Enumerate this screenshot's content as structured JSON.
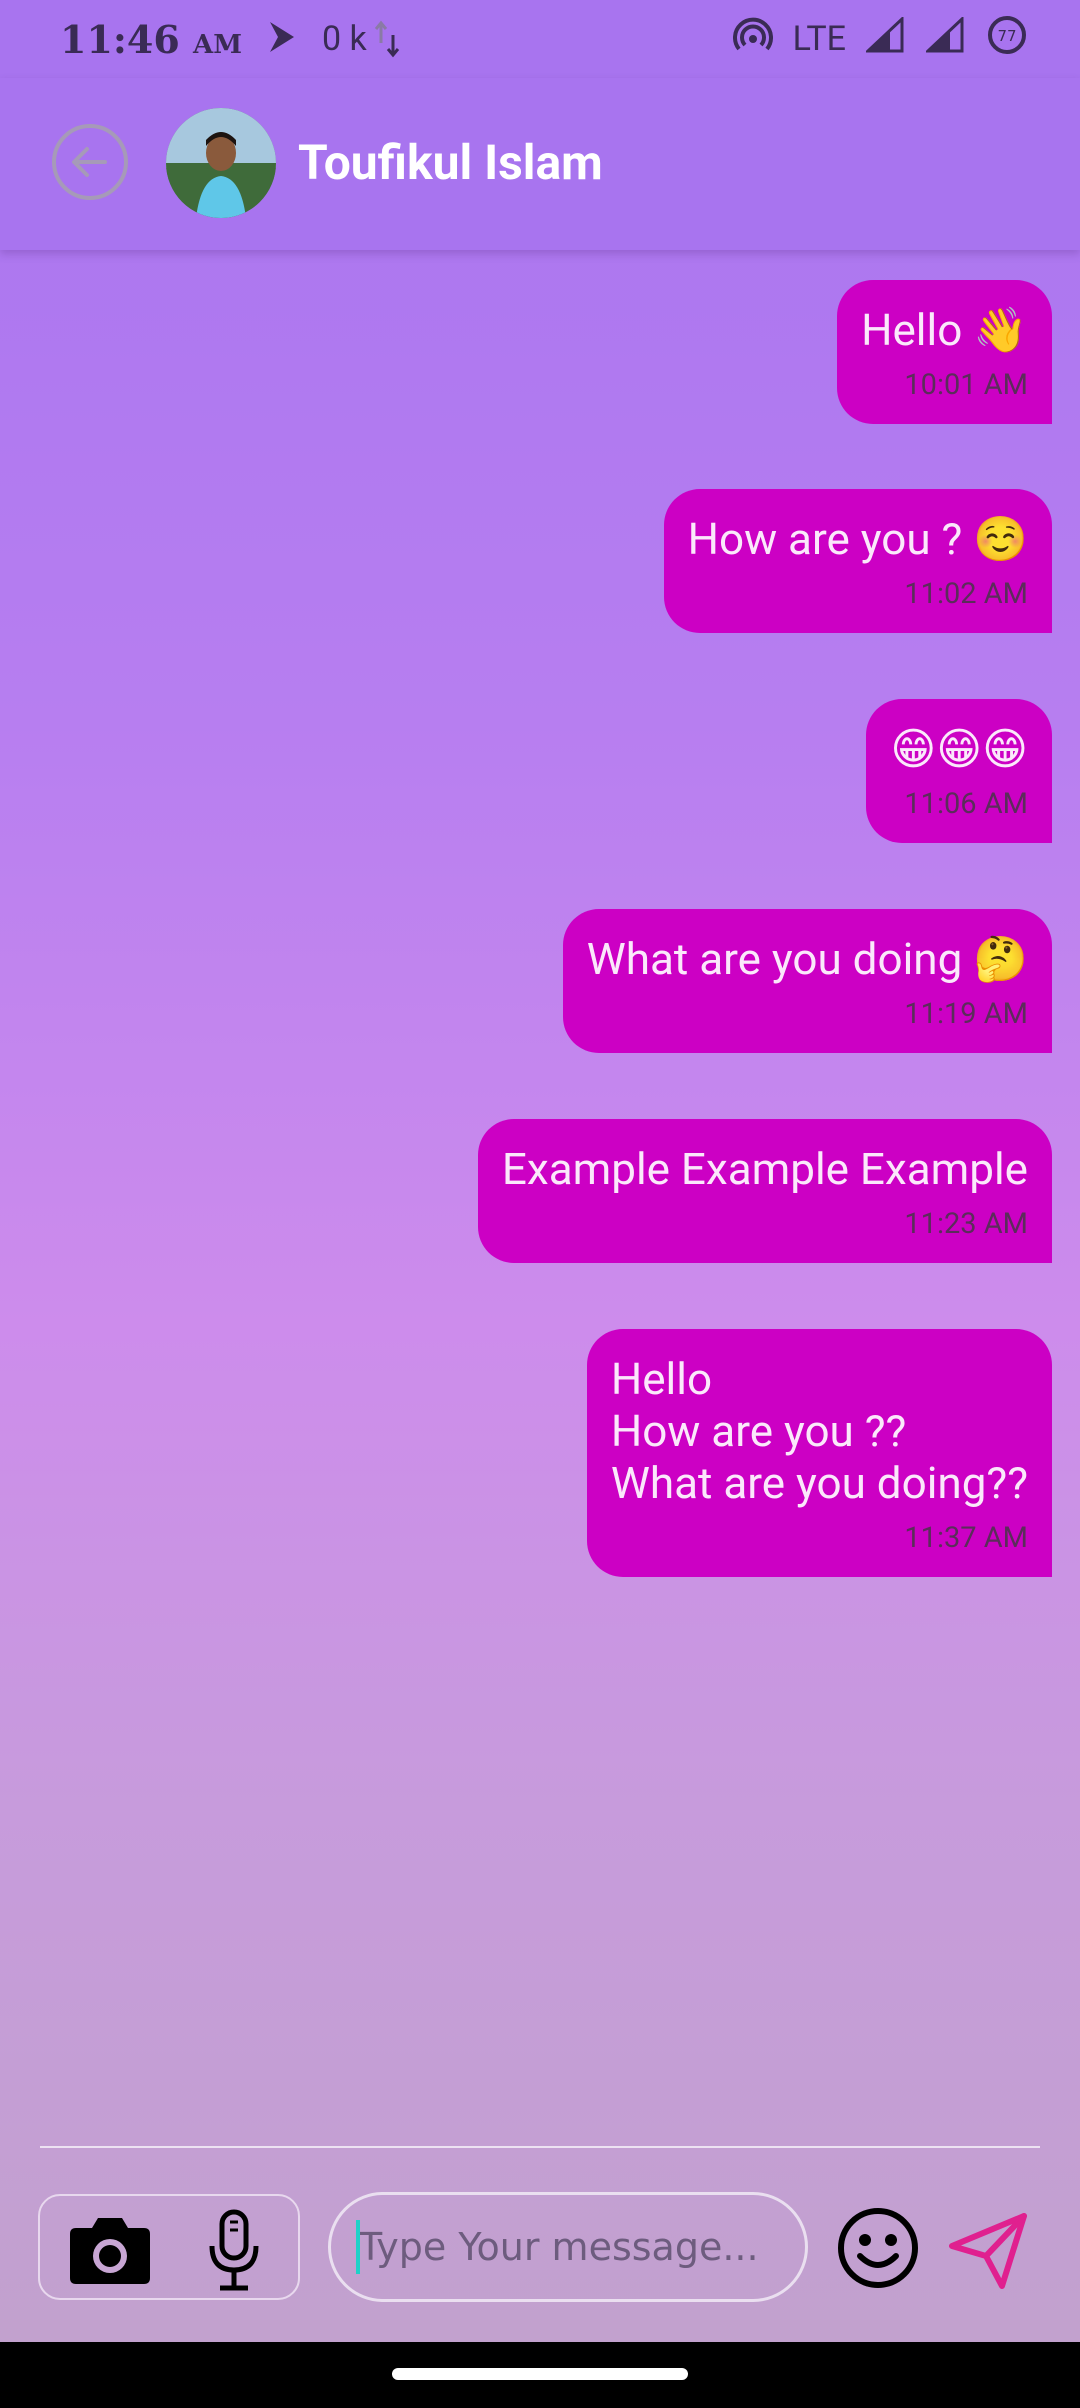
{
  "status_bar": {
    "time": "11:46",
    "ampm": "AM",
    "net_speed": "0 k",
    "network": "LTE",
    "battery": "77"
  },
  "header": {
    "contact_name": "Toufikul Islam"
  },
  "messages": [
    {
      "text": "Hello 👋",
      "time": "10:01 AM"
    },
    {
      "text": "How are you ? ☺️",
      "time": "11:02 AM"
    },
    {
      "text": "😁😁😁",
      "time": "11:06 AM"
    },
    {
      "text": "What are you doing 🤔",
      "time": "11:19 AM"
    },
    {
      "text": "Example Example Example",
      "time": "11:23 AM"
    },
    {
      "text": "Hello\nHow are you ??\nWhat are you doing??",
      "time": "11:37 AM"
    }
  ],
  "composer": {
    "placeholder": "Type Your message..."
  },
  "colors": {
    "bubble": "#cc00c4",
    "appbar": "#a874ef",
    "send_icon": "#e0208f"
  }
}
